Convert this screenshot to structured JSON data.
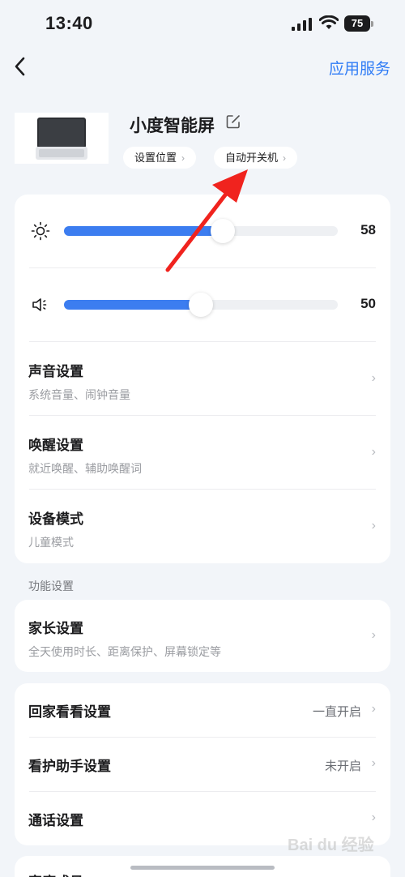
{
  "status_bar": {
    "time": "13:40",
    "battery": "75"
  },
  "nav": {
    "action_label": "应用服务"
  },
  "device": {
    "name": "小度智能屏",
    "chips": [
      {
        "label": "设置位置"
      },
      {
        "label": "自动开关机"
      }
    ]
  },
  "sliders": {
    "brightness": {
      "value": "58",
      "fraction": 0.58
    },
    "volume": {
      "value": "50",
      "fraction": 0.5
    }
  },
  "settings": [
    {
      "title": "声音设置",
      "subtitle": "系统音量、闹钟音量"
    },
    {
      "title": "唤醒设置",
      "subtitle": "就近唤醒、辅助唤醒词"
    },
    {
      "title": "设备模式",
      "subtitle": "儿童模式"
    }
  ],
  "function_section": {
    "label": "功能设置",
    "item": {
      "title": "家长设置",
      "subtitle": "全天使用时长、距离保护、屏幕锁定等"
    }
  },
  "more_settings": [
    {
      "title": "回家看看设置",
      "value": "一直开启"
    },
    {
      "title": "看护助手设置",
      "value": "未开启"
    },
    {
      "title": "通话设置",
      "value": ""
    }
  ],
  "bottom_partial": {
    "title": "家庭成员"
  },
  "watermark": "Bai du 经验",
  "colors": {
    "accent": "#2f7cf6",
    "slider_fill": "#3c7df0",
    "annotation_arrow": "#f0231e"
  }
}
